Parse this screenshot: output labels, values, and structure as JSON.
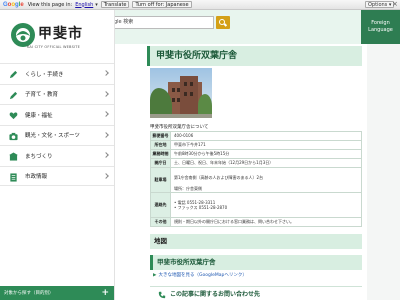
{
  "translate_bar": {
    "google": "Google",
    "view_text": "View this page in:",
    "language": "English",
    "translate": "Translate",
    "turn_off": "Turn off for: Japanese",
    "options": "Options ▾",
    "close": "×"
  },
  "logo": {
    "name": "甲斐市",
    "sub": "KAI CITY OFFICIAL WEBSITE"
  },
  "search": {
    "value": "Google 検索"
  },
  "lang_button": "Foreign Language",
  "nav": [
    {
      "label": "くらし・手続き",
      "icon": "pencil-icon"
    },
    {
      "label": "子育て・教育",
      "icon": "pencil-icon"
    },
    {
      "label": "健康・福祉",
      "icon": "heart-icon"
    },
    {
      "label": "観光・文化・スポーツ",
      "icon": "camera-icon"
    },
    {
      "label": "まちづくり",
      "icon": "building-icon"
    },
    {
      "label": "市政情報",
      "icon": "document-icon"
    }
  ],
  "side_footer": "対象から探す（目的別）",
  "page_title": "甲斐市役所双葉庁舎",
  "caption": "甲斐市役所双葉庁舎について",
  "table": [
    {
      "h": "郵便番号",
      "v": [
        "400-0106"
      ]
    },
    {
      "h": "所在地",
      "v": [
        "甲斐市下今井171"
      ]
    },
    {
      "h": "業務時間",
      "v": [
        "午前8時30分から午後5時15分"
      ]
    },
    {
      "h": "開庁日",
      "v": [
        "土、日曜日、祝日、年末年始（12月29日から1月3日）"
      ]
    },
    {
      "h": "駐車場",
      "v": [
        "",
        "第1庁舎南側（高齢の人および障害のある人）2台",
        "",
        "場所：庁舎東側"
      ]
    },
    {
      "h": "連絡先",
      "v": [
        "",
        "電話 0551-28-3311",
        "ファックス 0551-28-2870",
        ""
      ]
    },
    {
      "h": "その他",
      "v": [
        "規則・期日以外の開庁日における窓口業務は、問い合わせ下さい。"
      ]
    }
  ],
  "map_heading": "地図",
  "map_subheading": "甲斐市役所双葉庁舎",
  "map_link": "大きな地図を見る（GoogleMapへリンク）",
  "contact": "この記事に関するお問い合わせ先",
  "colors": {
    "accent": "#2e8b57",
    "header_bg": "#e8f5ee",
    "search_btn": "#d4a017"
  }
}
